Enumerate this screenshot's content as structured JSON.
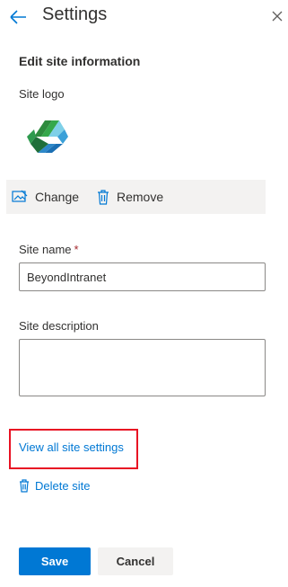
{
  "header": {
    "title": "Settings",
    "back_icon": "arrow-left-icon",
    "close_icon": "close-icon"
  },
  "section_title": "Edit site information",
  "logo": {
    "label": "Site logo",
    "change_label": "Change",
    "change_icon": "image-icon",
    "remove_label": "Remove",
    "remove_icon": "trash-icon"
  },
  "site_name": {
    "label": "Site name",
    "required_marker": "*",
    "value": "BeyondIntranet"
  },
  "site_description": {
    "label": "Site description",
    "value": ""
  },
  "links": {
    "view_all": "View all site settings",
    "delete": "Delete site",
    "delete_icon": "trash-icon"
  },
  "buttons": {
    "save": "Save",
    "cancel": "Cancel"
  },
  "colors": {
    "accent": "#0078d4",
    "highlight": "#e81123",
    "required": "#a4262c"
  }
}
